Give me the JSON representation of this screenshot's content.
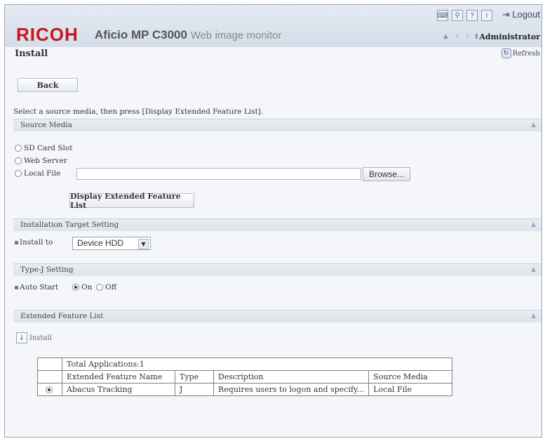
{
  "header": {
    "brand": "RICOH",
    "model": "Aficio MP C3000",
    "subtitle": "Web image monitor",
    "logout_label": "Logout",
    "user": "Administrator"
  },
  "page": {
    "title": "Install",
    "refresh_label": "Refresh",
    "back_label": "Back",
    "instruction": "Select a source media, then press [Display Extended Feature List]."
  },
  "source_media": {
    "title": "Source Media",
    "options": [
      "SD Card Slot",
      "Web Server",
      "Local File"
    ],
    "local_file_value": "",
    "browse_label": "Browse...",
    "display_button": "Display Extended Feature List"
  },
  "target": {
    "title": "Installation Target Setting",
    "label": "Install to",
    "selected": "Device HDD"
  },
  "typej": {
    "title": "Type-J Setting",
    "label": "Auto Start",
    "on_label": "On",
    "off_label": "Off"
  },
  "feature_list": {
    "title": "Extended Feature List",
    "install_label": "Install",
    "total": "Total Applications:1",
    "columns": [
      "Extended Feature Name",
      "Type",
      "Description",
      "Source Media"
    ],
    "rows": [
      {
        "name": "Abacus Tracking",
        "type": "J",
        "description": "Requires users to logon and specify...",
        "source": "Local File"
      }
    ]
  }
}
